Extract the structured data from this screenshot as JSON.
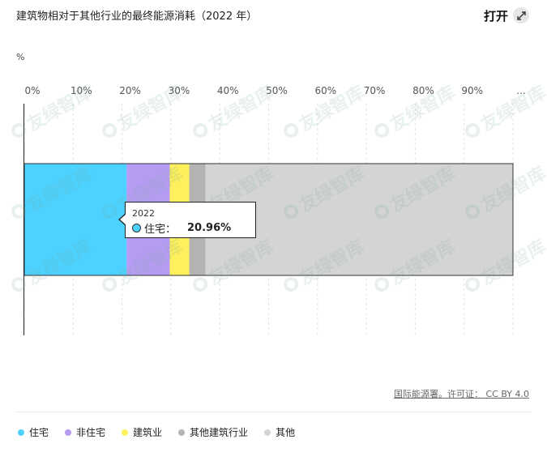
{
  "title": "建筑物相对于其他行业的最终能源消耗（2022 年）",
  "open_label": "打开",
  "expand_icon": "expand-arrows-icon",
  "unit_label": "%",
  "source_label": "国际能源署。许可证： CC BY 4.0",
  "watermark_text": "友绿智库",
  "tooltip": {
    "year": "2022",
    "label": "住宅：",
    "value": "20.96%"
  },
  "chart_data": {
    "type": "bar",
    "orientation": "horizontal",
    "stacked": true,
    "categories": [
      "2022"
    ],
    "series": [
      {
        "name": "住宅",
        "values": [
          20.96
        ],
        "color": "#4dd2ff"
      },
      {
        "name": "非住宅",
        "values": [
          8.8
        ],
        "color": "#b59cf2"
      },
      {
        "name": "建筑业",
        "values": [
          4.0
        ],
        "color": "#fdf05c"
      },
      {
        "name": "其他建筑行业",
        "values": [
          3.3
        ],
        "color": "#b3b3b3"
      },
      {
        "name": "其他",
        "values": [
          62.94
        ],
        "color": "#d4d4d4"
      }
    ],
    "x_ticks": [
      "0%",
      "10%",
      "20%",
      "30%",
      "40%",
      "50%",
      "60%",
      "70%",
      "80%",
      "90%",
      "..."
    ],
    "xlim": [
      0,
      100
    ],
    "xlabel": "%",
    "grid": true,
    "legend_position": "bottom"
  }
}
